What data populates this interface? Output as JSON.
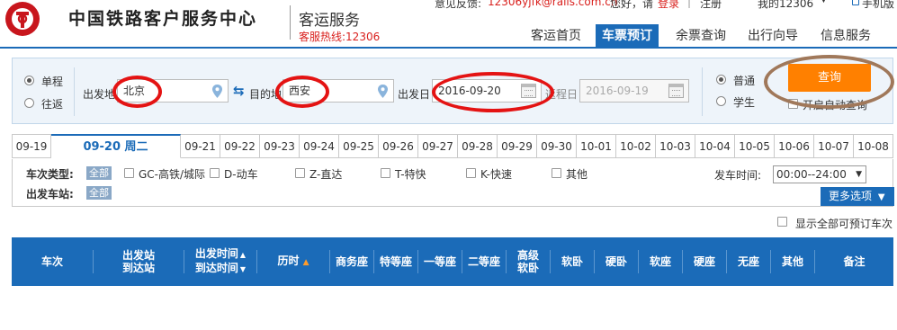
{
  "header": {
    "site_title": "中国铁路客户服务中心",
    "subtitle": "客运服务",
    "hotline": "客服热线:12306"
  },
  "top_links": {
    "feedback_label": "意见反馈:",
    "feedback_email": "12306yjfk@rails.com.cn",
    "greeting": "您好，请",
    "login": "登录",
    "divider": "|",
    "register": "注册",
    "my_account": "我的12306",
    "caret": "▼",
    "mobile": "手机版"
  },
  "nav": {
    "home": "客运首页",
    "book": "车票预订",
    "remain": "余票查询",
    "guide": "出行向导",
    "info": "信息服务"
  },
  "search": {
    "trip_single": "单程",
    "trip_return": "往返",
    "from_label": "出发地",
    "from_value": "北京",
    "swap_icon": "⇆",
    "to_label": "目的地",
    "to_value": "西安",
    "depart_label": "出发日",
    "depart_value": "2016-09-20",
    "return_label": "返程日",
    "return_value": "2016-09-19",
    "type_normal": "普通",
    "type_student": "学生",
    "query_button": "查询",
    "auto_query": "开启自动查询"
  },
  "date_tabs": [
    {
      "label": "09-19"
    },
    {
      "label": "09-20 周二",
      "active": true
    },
    {
      "label": "09-21"
    },
    {
      "label": "09-22"
    },
    {
      "label": "09-23"
    },
    {
      "label": "09-24"
    },
    {
      "label": "09-25"
    },
    {
      "label": "09-26"
    },
    {
      "label": "09-27"
    },
    {
      "label": "09-28"
    },
    {
      "label": "09-29"
    },
    {
      "label": "09-30"
    },
    {
      "label": "10-01"
    },
    {
      "label": "10-02"
    },
    {
      "label": "10-03"
    },
    {
      "label": "10-04"
    },
    {
      "label": "10-05"
    },
    {
      "label": "10-06"
    },
    {
      "label": "10-07"
    },
    {
      "label": "10-08"
    }
  ],
  "filters": {
    "train_type_label": "车次类型:",
    "all": "全部",
    "types": [
      "GC-高铁/城际",
      "D-动车",
      "Z-直达",
      "T-特快",
      "K-快速",
      "其他"
    ],
    "station_label": "出发车站:",
    "time_label": "发车时间:",
    "time_value": "00:00--24:00",
    "more_options": "更多选项"
  },
  "show_all": "显示全部可预订车次",
  "table_header": {
    "train_no": "车次",
    "station_depart": "出发站",
    "station_arrive": "到达站",
    "time_depart": "出发时间",
    "time_arrive": "到达时间",
    "duration": "历时",
    "business": "商务座",
    "premium": "特等座",
    "first": "一等座",
    "second": "二等座",
    "adv_soft_top": "高级",
    "adv_soft_bottom": "软卧",
    "soft_sleeper": "软卧",
    "hard_sleeper": "硬卧",
    "soft_seat": "软座",
    "hard_seat": "硬座",
    "no_seat": "无座",
    "other": "其他",
    "remark": "备注"
  },
  "colors": {
    "brand_blue": "#1b6bb8",
    "accent_orange": "#ff8000",
    "annotation_red": "#e41313"
  }
}
